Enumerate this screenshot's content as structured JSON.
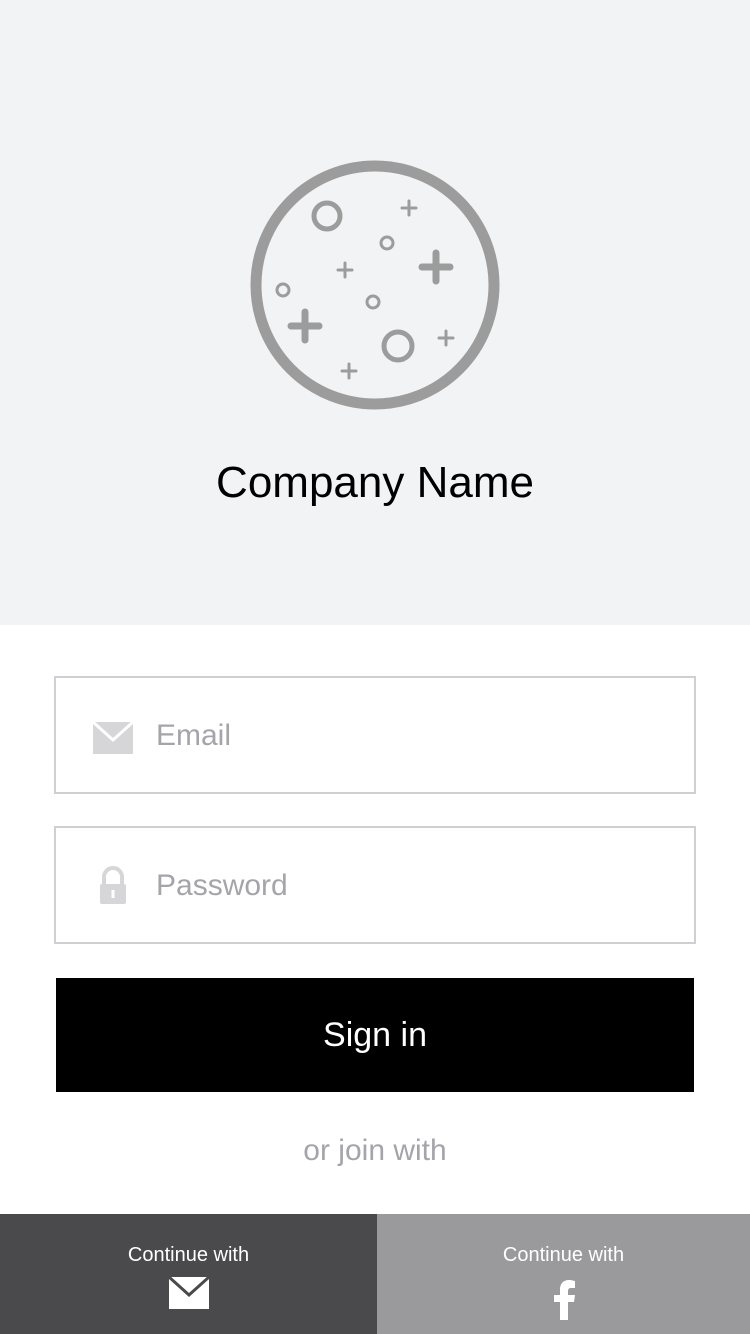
{
  "header": {
    "company_name": "Company Name",
    "logo_icon": "planet-logo-icon",
    "background": "#f2f3f5"
  },
  "form": {
    "email": {
      "placeholder": "Email",
      "value": "",
      "icon": "envelope-icon"
    },
    "password": {
      "placeholder": "Password",
      "value": "",
      "icon": "lock-icon"
    },
    "signin_label": "Sign in"
  },
  "social": {
    "join_text": "or join with",
    "email": {
      "label": "Continue with",
      "icon": "envelope-icon",
      "color": "#4a4a4c"
    },
    "facebook": {
      "label": "Continue with",
      "icon": "facebook-icon",
      "color": "#9a9a9c"
    }
  },
  "colors": {
    "button_bg": "#000000",
    "button_text": "#ffffff",
    "placeholder": "#a4a4aa"
  }
}
